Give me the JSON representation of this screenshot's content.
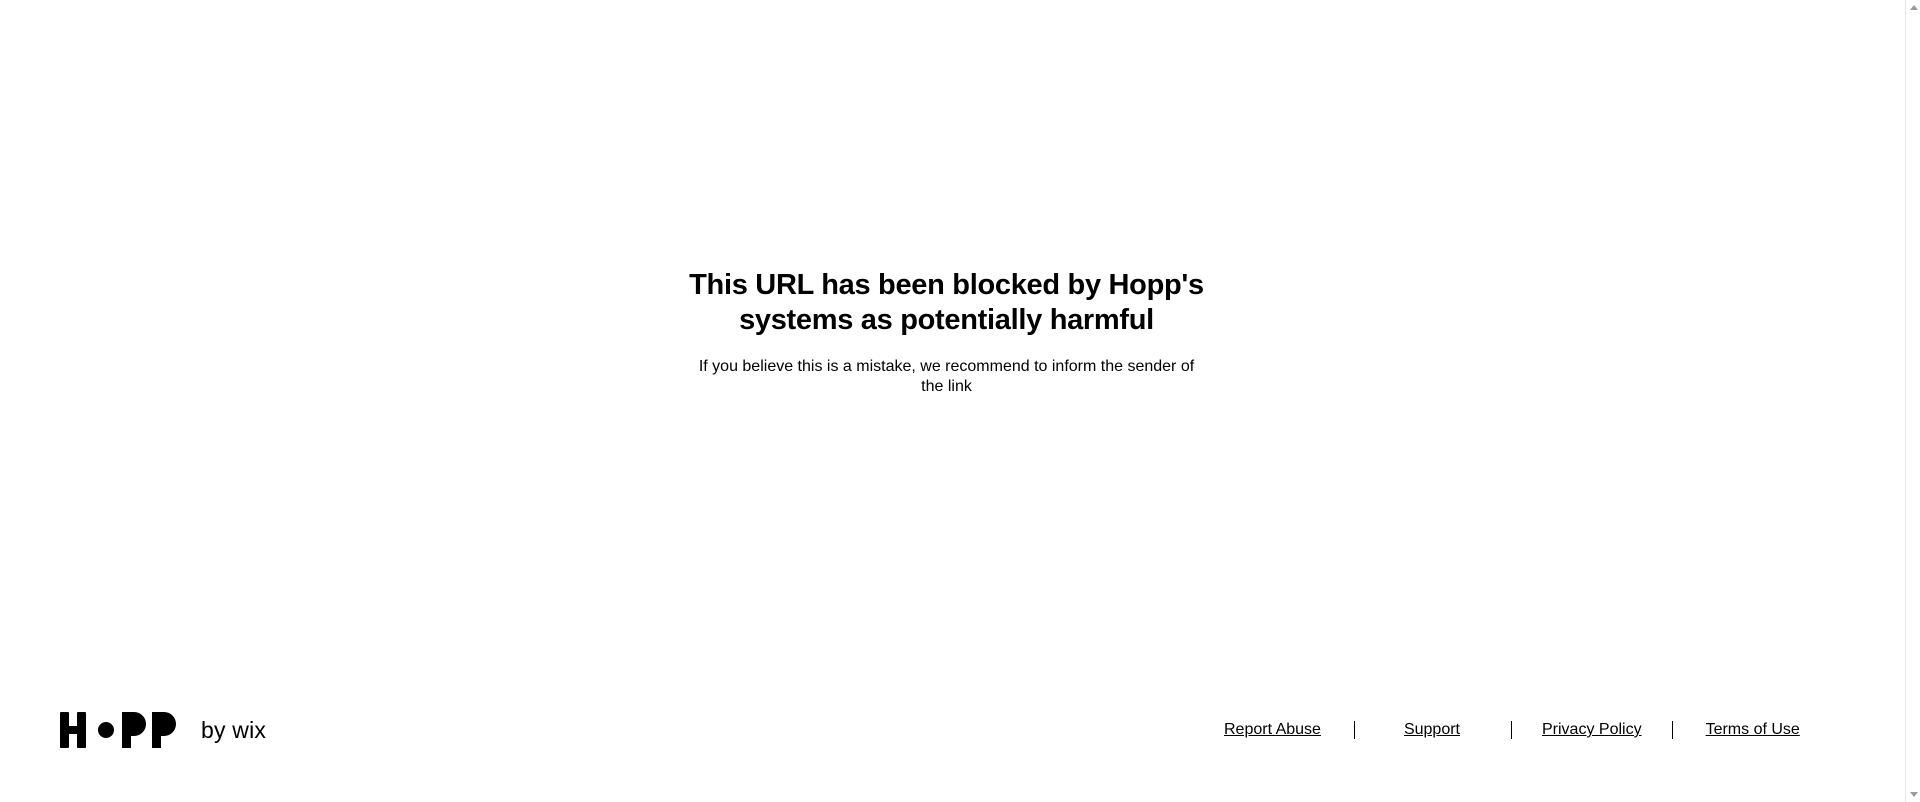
{
  "message": {
    "heading": "This URL has been blocked by Hopp's systems as potentially harmful",
    "body": "If you believe this is a mistake, we recommend to inform the sender of the link"
  },
  "brand": {
    "logo_text": "HOPP",
    "byline": "by wix"
  },
  "footer": {
    "links": [
      {
        "label": "Report Abuse"
      },
      {
        "label": "Support"
      },
      {
        "label": "Privacy Policy"
      },
      {
        "label": "Terms of Use"
      }
    ]
  },
  "colors": {
    "text": "#000000",
    "background": "#ffffff"
  },
  "icons": [
    "hopp-logo-icon",
    "scroll-up-arrow-icon",
    "scroll-down-arrow-icon"
  ]
}
